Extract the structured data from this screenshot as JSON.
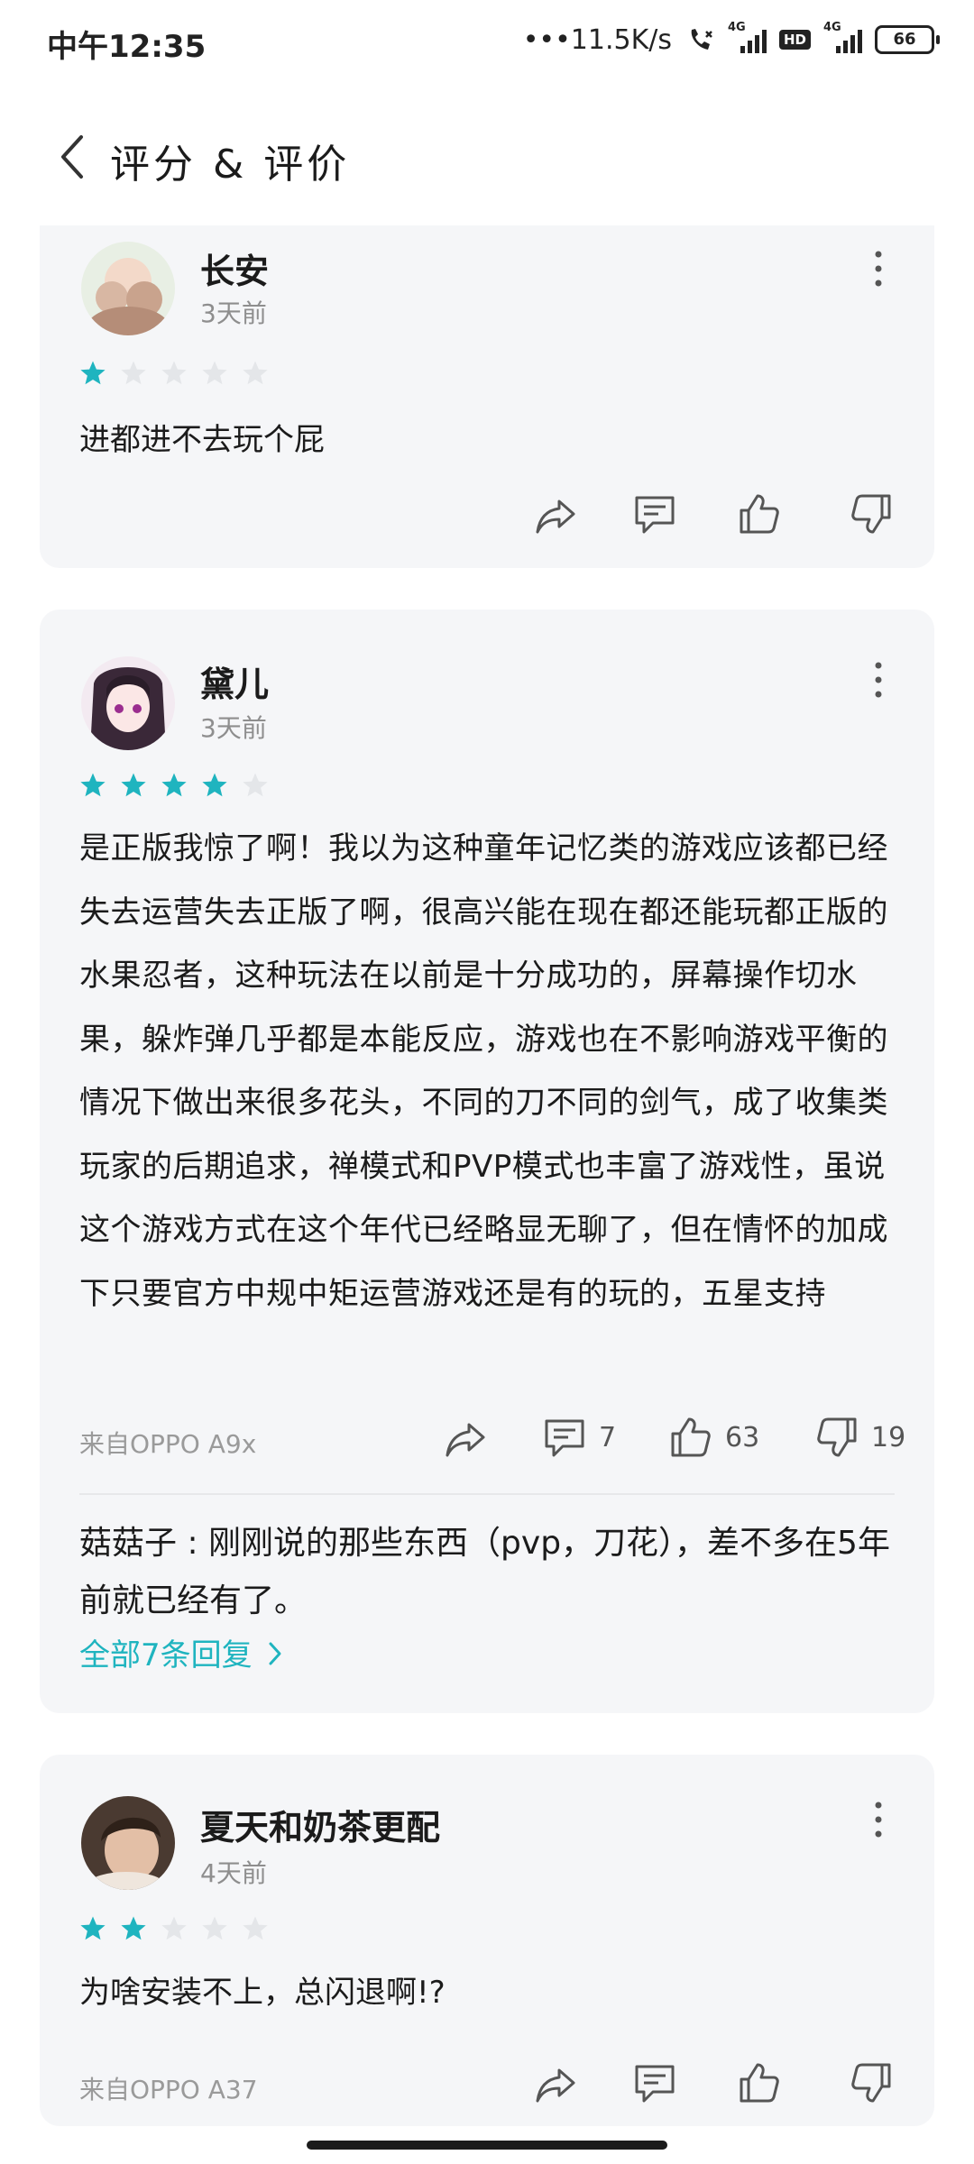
{
  "status_bar": {
    "time": "中午12:35",
    "speed": "•••11.5K/s",
    "net1": "4G",
    "hd": "HD",
    "net2": "4G",
    "battery": "66"
  },
  "header": {
    "title": "评分 & 评价",
    "back_icon": "chevron-left-icon"
  },
  "colors": {
    "star_filled": "#1fb4bf",
    "star_empty": "#e4e6e9",
    "accent": "#1fb4bf",
    "card_bg": "#f5f6f8"
  },
  "reviews": [
    {
      "user": "长安",
      "time": "3天前",
      "rating": 1,
      "text": "进都进不去玩个屁",
      "device": "",
      "comments": "",
      "likes": "",
      "dislikes": ""
    },
    {
      "user": "黛儿",
      "time": "3天前",
      "rating": 4,
      "text": "是正版我惊了啊！我以为这种童年记忆类的游戏应该都已经失去运营失去正版了啊，很高兴能在现在都还能玩都正版的水果忍者，这种玩法在以前是十分成功的，屏幕操作切水果，躲炸弹几乎都是本能反应，游戏也在不影响游戏平衡的情况下做出来很多花头，不同的刀不同的剑气，成了收集类玩家的后期追求，禅模式和PVP模式也丰富了游戏性，虽说这个游戏方式在这个年代已经略显无聊了，但在情怀的加成下只要官方中规中矩运营游戏还是有的玩的，五星支持",
      "device": "来自OPPO A9x",
      "comments": "7",
      "likes": "63",
      "dislikes": "19",
      "reply_author": "菇菇子",
      "reply_text": "刚刚说的那些东西（pvp，刀花），差不多在5年前就已经有了。",
      "all_replies": "全部7条回复"
    },
    {
      "user": "夏天和奶茶更配",
      "time": "4天前",
      "rating": 2,
      "text": "为啥安装不上，总闪退啊!?",
      "device": "来自OPPO A37",
      "comments": "",
      "likes": "",
      "dislikes": ""
    }
  ]
}
